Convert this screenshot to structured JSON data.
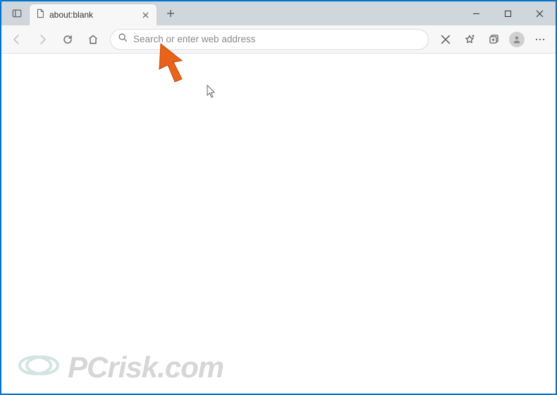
{
  "tab": {
    "title": "about:blank"
  },
  "address": {
    "placeholder": "Search or enter web address",
    "value": ""
  },
  "watermark": {
    "text": "PCrisk.com"
  }
}
